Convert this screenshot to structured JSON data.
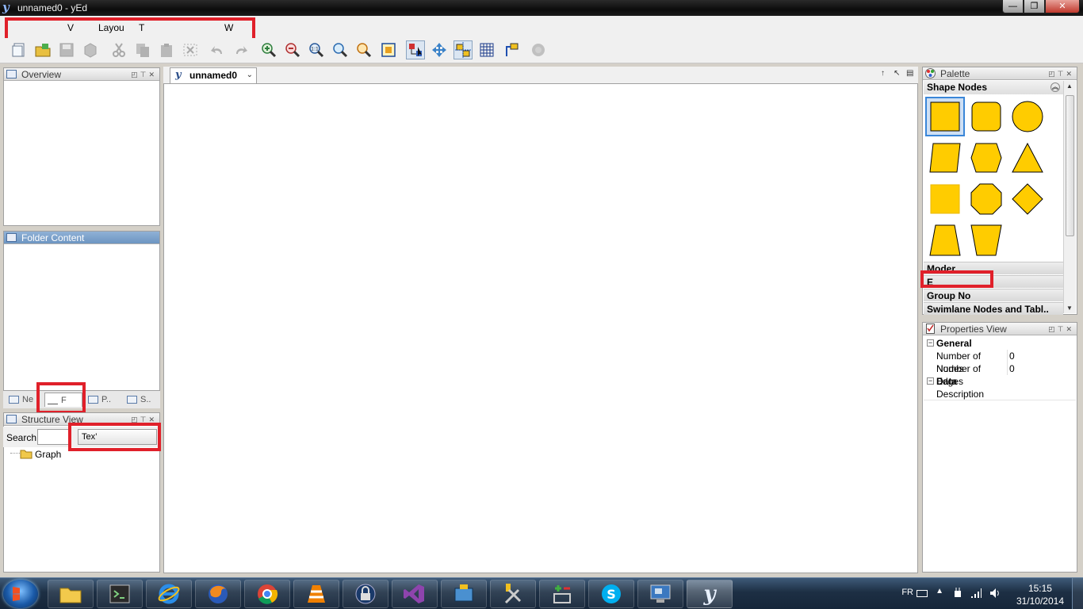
{
  "window": {
    "title": "unnamed0 - yEd",
    "controls": {
      "minimize": "—",
      "maximize": "❐",
      "close": "✕"
    }
  },
  "menubar": {
    "items": [
      "V",
      "Layou",
      "T",
      "W"
    ]
  },
  "toolbar": {
    "buttons": [
      "new-document",
      "open",
      "save",
      "save-as",
      "cut",
      "copy",
      "paste",
      "delete",
      "undo",
      "redo",
      "zoom-in",
      "zoom-out",
      "zoom-1-1",
      "zoom",
      "zoom-selection",
      "fit-content",
      "edit-mode",
      "navigation-mode",
      "snap-lines",
      "grid",
      "orthogonal-edges",
      "network"
    ],
    "zoom_1_1_label": "1:1"
  },
  "overview": {
    "title": "Overview"
  },
  "folder_content": {
    "title": "Folder Content"
  },
  "left_tabs": [
    {
      "label": "Ne"
    },
    {
      "label": "F"
    },
    {
      "label": "P.."
    },
    {
      "label": "S.."
    }
  ],
  "structure_view": {
    "title": "Structure View",
    "search_label": "Search",
    "search_value": "",
    "filter_selected": "Tex’",
    "tree": [
      {
        "label": "Graph"
      }
    ]
  },
  "document": {
    "tab_label": "unnamed0",
    "controls": [
      "↑",
      "↖",
      "▤"
    ]
  },
  "palette": {
    "title": "Palette",
    "section": "Shape Nodes",
    "shapes": [
      "rectangle",
      "round-rectangle",
      "ellipse",
      "parallelogram",
      "hexagon",
      "triangle",
      "rectangle-flat",
      "octagon",
      "diamond",
      "trapezoid",
      "trapezoid-inverted"
    ],
    "selected_shape": "rectangle",
    "shape_fill": "#ffcc00",
    "collapsed_sections": [
      "Moder",
      "E",
      "Group No",
      "Swimlane Nodes and Tabl.."
    ]
  },
  "properties": {
    "title": "Properties View",
    "groups": [
      {
        "name": "General",
        "toggle": "−",
        "rows": [
          {
            "key": "Number of Nodes",
            "value": "0"
          },
          {
            "key": "Number of Edges",
            "value": "0"
          }
        ]
      },
      {
        "name": "Data",
        "toggle": "−",
        "rows": [
          {
            "key": "Description",
            "value": ""
          }
        ]
      }
    ]
  },
  "taskbar": {
    "apps": [
      "explorer",
      "terminal",
      "internet-explorer",
      "firefox",
      "chrome",
      "vlc",
      "keepass",
      "visual-studio",
      "toolbox",
      "tools",
      "calculator-tool",
      "skype",
      "remote-desktop",
      "yed"
    ],
    "active_app": "yed",
    "language": "FR",
    "time": "15:15",
    "date": "31/10/2014"
  },
  "colors": {
    "annotation_red": "#e0202a",
    "selection_blue": "#3a86d8",
    "panel_active_header": "#6d95c2"
  }
}
